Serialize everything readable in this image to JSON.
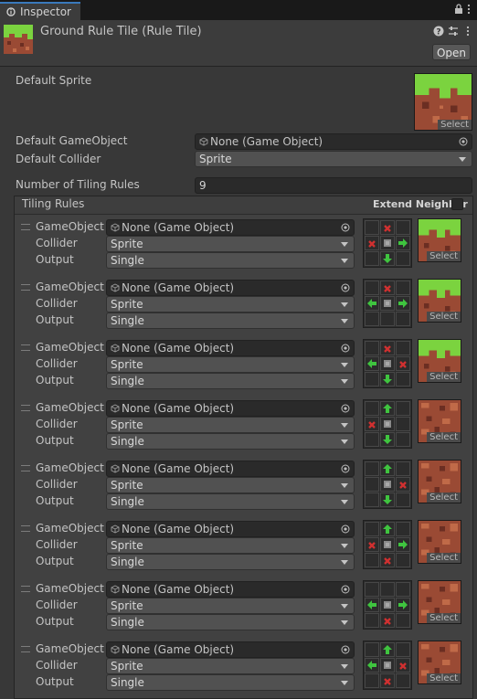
{
  "tab": {
    "label": "Inspector",
    "icon": "inspector-icon"
  },
  "header": {
    "title": "Ground Rule Tile (Rule Tile)",
    "open_label": "Open"
  },
  "fields": {
    "default_sprite_label": "Default Sprite",
    "default_sprite_select": "Select",
    "default_gameobject_label": "Default GameObject",
    "default_gameobject_value": "None (Game Object)",
    "default_collider_label": "Default Collider",
    "default_collider_value": "Sprite",
    "num_rules_label": "Number of Tiling Rules",
    "num_rules_value": "9"
  },
  "tiling": {
    "title": "Tiling Rules",
    "extend_neighbor_label": "Extend Neighbor",
    "extend_neighbor_checked": false
  },
  "rule_labels": {
    "gameobject": "GameObject",
    "collider": "Collider",
    "output": "Output",
    "select": "Select"
  },
  "rules": [
    {
      "gameobject": "None (Game Object)",
      "collider": "Sprite",
      "output": "Single",
      "sprite": "grass",
      "neighbors": [
        "",
        "x",
        "",
        "x",
        "c",
        "a",
        "",
        "v",
        ""
      ]
    },
    {
      "gameobject": "None (Game Object)",
      "collider": "Sprite",
      "output": "Single",
      "sprite": "grass",
      "neighbors": [
        "",
        "x",
        "",
        "a",
        "c",
        "a",
        "",
        "",
        ""
      ]
    },
    {
      "gameobject": "None (Game Object)",
      "collider": "Sprite",
      "output": "Single",
      "sprite": "grass",
      "neighbors": [
        "",
        "x",
        "",
        "a",
        "c",
        "x",
        "",
        "v",
        ""
      ]
    },
    {
      "gameobject": "None (Game Object)",
      "collider": "Sprite",
      "output": "Single",
      "sprite": "dirt",
      "neighbors": [
        "",
        "^",
        "",
        "x",
        "c",
        "",
        "",
        "v",
        ""
      ]
    },
    {
      "gameobject": "None (Game Object)",
      "collider": "Sprite",
      "output": "Single",
      "sprite": "dirt",
      "neighbors": [
        "",
        "^",
        "",
        "",
        "c",
        "x",
        "",
        "v",
        ""
      ]
    },
    {
      "gameobject": "None (Game Object)",
      "collider": "Sprite",
      "output": "Single",
      "sprite": "dirt",
      "neighbors": [
        "",
        "^",
        "",
        "x",
        "c",
        "a",
        "",
        "x",
        ""
      ]
    },
    {
      "gameobject": "None (Game Object)",
      "collider": "Sprite",
      "output": "Single",
      "sprite": "dirt",
      "neighbors": [
        "",
        "",
        "",
        "a",
        "c",
        "a",
        "",
        "x",
        ""
      ]
    },
    {
      "gameobject": "None (Game Object)",
      "collider": "Sprite",
      "output": "Single",
      "sprite": "dirt",
      "neighbors": [
        "",
        "^",
        "",
        "a",
        "c",
        "x",
        "",
        "x",
        ""
      ]
    }
  ],
  "colors": {
    "rule_green": "#3fc43f",
    "rule_red": "#d03030",
    "accent_blue": "#3a79bb"
  }
}
